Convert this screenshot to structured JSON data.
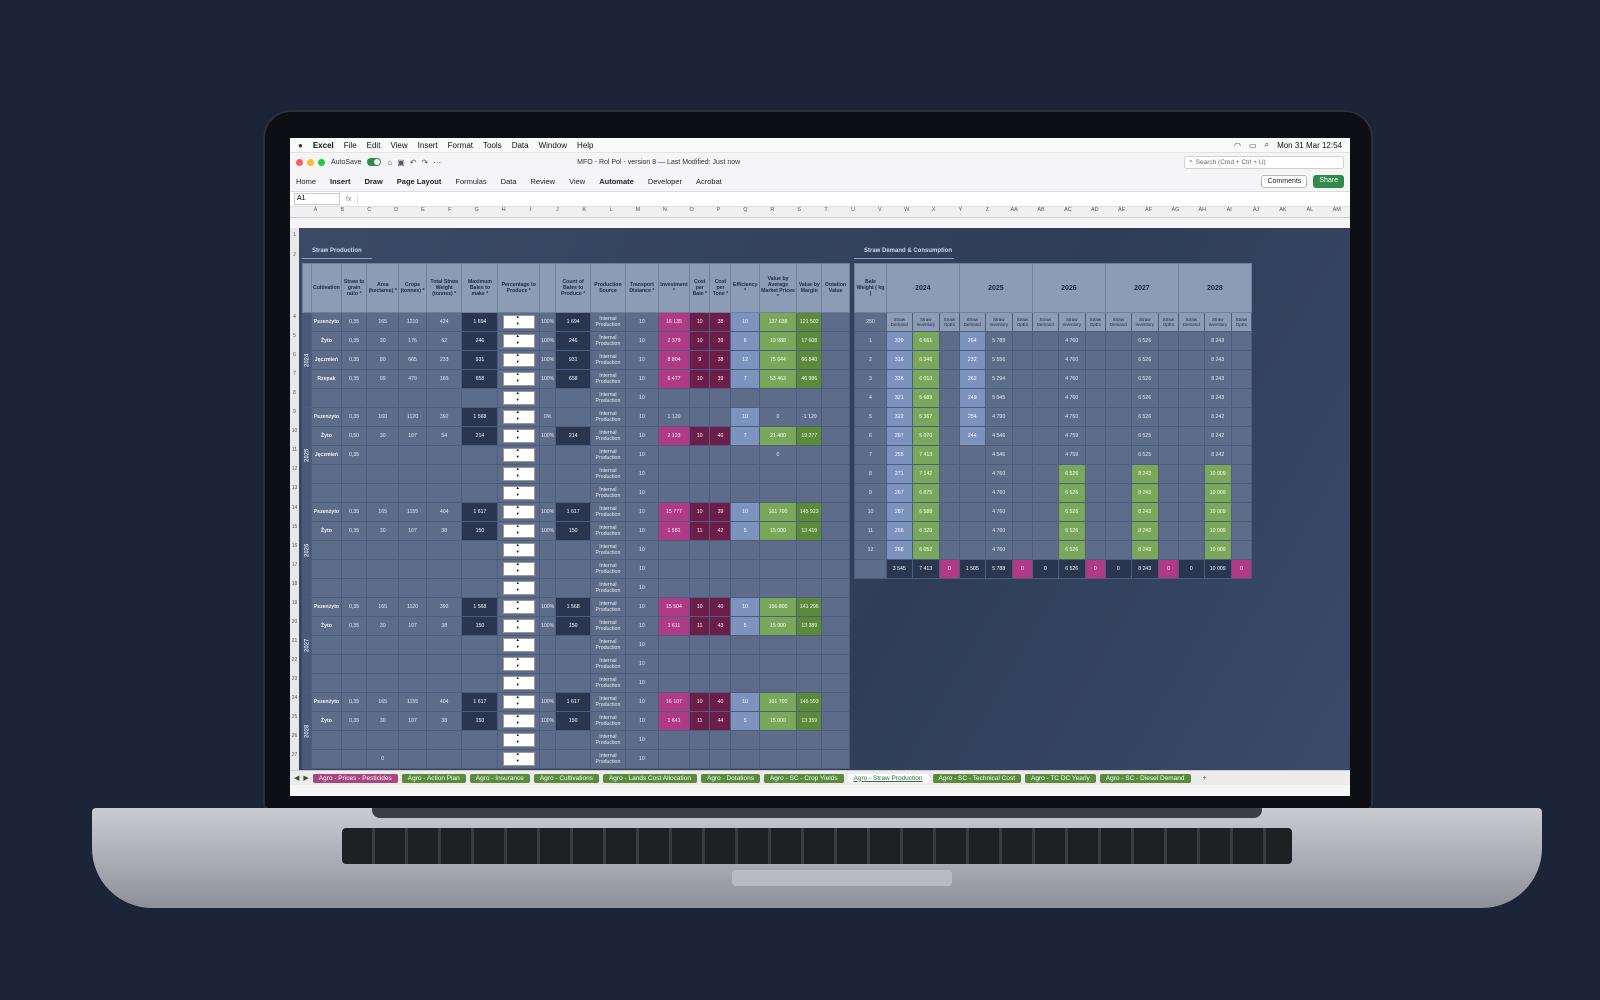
{
  "menubar": {
    "apple": "",
    "app": "Excel",
    "items": [
      "File",
      "Edit",
      "View",
      "Insert",
      "Format",
      "Tools",
      "Data",
      "Window",
      "Help"
    ],
    "clock": "Mon 31 Mar  12:54"
  },
  "titlebar": {
    "autosave": "AutoSave",
    "doc": "MFO - Rol Pol - version 8 — Last Modified: Just now",
    "search": "Search (Cmd + Ctrl + U)"
  },
  "ribbon": {
    "tabs": [
      "Home",
      "Insert",
      "Draw",
      "Page Layout",
      "Formulas",
      "Data",
      "Review",
      "View",
      "Automate",
      "Developer",
      "Acrobat"
    ],
    "comments": "Comments",
    "share": "Share"
  },
  "formula": {
    "cell": "A1",
    "fx": "fx"
  },
  "columns": [
    "A",
    "B",
    "C",
    "D",
    "E",
    "F",
    "G",
    "H",
    "I",
    "J",
    "K",
    "L",
    "M",
    "N",
    "O",
    "P",
    "Q",
    "R",
    "S",
    "T",
    "U",
    "V",
    "W",
    "X",
    "Y",
    "Z",
    "AA",
    "AB",
    "AC",
    "AD",
    "AE",
    "AF",
    "AG",
    "AH",
    "AI",
    "AJ",
    "AK",
    "AL",
    "AM"
  ],
  "rows": [
    "1",
    "2",
    "4",
    "5",
    "6",
    "7",
    "8",
    "9",
    "10",
    "11",
    "12",
    "13",
    "14",
    "15",
    "16",
    "17",
    "18",
    "19",
    "20",
    "21",
    "22",
    "23",
    "24",
    "25",
    "26",
    "27",
    "28"
  ],
  "left": {
    "title": "Straw Production",
    "headers": [
      "Cultivation",
      "Straw to grain ratio *",
      "Area (hectares) *",
      "Crops (tonnes) *",
      "Total Straw Weight (tonnes) *",
      "Maximum Bales to make *",
      "Percentage to Produce *",
      "",
      "Count of Bales to Produce *",
      "Production Source",
      "Transport Distance *",
      "Investment *",
      "Cost per Bale *",
      "Cost per Tone *",
      "Efficiency *",
      "Value by Average Market Prices *",
      "Value by Margin",
      "Dotation Value"
    ],
    "years": [
      "2024",
      "2025",
      "2026",
      "2027",
      "2028"
    ],
    "rows": [
      [
        "Pszenżyto",
        "0,35",
        "165",
        "1210",
        "424",
        "1 694",
        "",
        "100%",
        "1 694",
        "Internal Production",
        "10",
        "16 135",
        "10",
        "38",
        "10",
        "137 638",
        "121 502",
        ""
      ],
      [
        "Żyto",
        "0,35",
        "30",
        "176",
        "62",
        "246",
        "",
        "100%",
        "246",
        "Internal Production",
        "10",
        "2 379",
        "10",
        "39",
        "6",
        "19 988",
        "17 608",
        ""
      ],
      [
        "Jęczmień",
        "0,35",
        "80",
        "665",
        "233",
        "931",
        "",
        "100%",
        "931",
        "Internal Production",
        "10",
        "8 804",
        "9",
        "38",
        "12",
        "75 644",
        "66 840",
        ""
      ],
      [
        "Rzepak",
        "0,35",
        "99",
        "470",
        "165",
        "658",
        "",
        "100%",
        "658",
        "Internal Production",
        "10",
        "6 477",
        "10",
        "39",
        "7",
        "53 463",
        "46 986",
        ""
      ],
      [
        "",
        "",
        "",
        "",
        "",
        "",
        "",
        "",
        "",
        "Internal Production",
        "10",
        "",
        "",
        "",
        "",
        "",
        "",
        ""
      ],
      [
        "Pszenżyto",
        "0,35",
        "160",
        "1120",
        "392",
        "1 568",
        "",
        "0%",
        "",
        "Internal Production",
        "10",
        "1 120",
        "",
        "",
        "10",
        "0",
        "-1 120",
        ""
      ],
      [
        "Żyto",
        "0,50",
        "30",
        "107",
        "54",
        "214",
        "",
        "100%",
        "214",
        "Internal Production",
        "10",
        "2 123",
        "10",
        "40",
        "7",
        "21 400",
        "19 277",
        ""
      ],
      [
        "Jęczmień",
        "0,35",
        "",
        "",
        "",
        "",
        "",
        "",
        "",
        "Internal Production",
        "10",
        "",
        "",
        "",
        "",
        "0",
        "",
        ""
      ],
      [
        "",
        "",
        "",
        "",
        "",
        "",
        "",
        "",
        "",
        "Internal Production",
        "10",
        "",
        "",
        "",
        "",
        "",
        "",
        ""
      ],
      [
        "",
        "",
        "",
        "",
        "",
        "",
        "",
        "",
        "",
        "Internal Production",
        "10",
        "",
        "",
        "",
        "",
        "",
        "",
        ""
      ],
      [
        "Pszenżyto",
        "0,35",
        "165",
        "1155",
        "404",
        "1 617",
        "",
        "100%",
        "1 617",
        "Internal Production",
        "10",
        "15 777",
        "10",
        "39",
        "10",
        "161 700",
        "145 923",
        ""
      ],
      [
        "Żyto",
        "0,35",
        "30",
        "107",
        "38",
        "150",
        "",
        "100%",
        "150",
        "Internal Production",
        "10",
        "1 581",
        "11",
        "42",
        "5",
        "15 000",
        "13 419",
        ""
      ],
      [
        "",
        "",
        "",
        "",
        "",
        "",
        "",
        "",
        "",
        "Internal Production",
        "10",
        "",
        "",
        "",
        "",
        "",
        "",
        ""
      ],
      [
        "",
        "",
        "",
        "",
        "",
        "",
        "",
        "",
        "",
        "Internal Production",
        "10",
        "",
        "",
        "",
        "",
        "",
        "",
        ""
      ],
      [
        "",
        "",
        "",
        "",
        "",
        "",
        "",
        "",
        "",
        "Internal Production",
        "10",
        "",
        "",
        "",
        "",
        "",
        "",
        ""
      ],
      [
        "Pszenżyto",
        "0,35",
        "165",
        "1120",
        "392",
        "1 568",
        "",
        "100%",
        "1 568",
        "Internal Production",
        "10",
        "15 504",
        "10",
        "40",
        "10",
        "156 800",
        "141 296",
        ""
      ],
      [
        "Żyto",
        "0,35",
        "30",
        "107",
        "38",
        "150",
        "",
        "100%",
        "150",
        "Internal Production",
        "10",
        "1 611",
        "11",
        "43",
        "5",
        "15 000",
        "13 389",
        ""
      ],
      [
        "",
        "",
        "",
        "",
        "",
        "",
        "",
        "",
        "",
        "Internal Production",
        "10",
        "",
        "",
        "",
        "",
        "",
        "",
        ""
      ],
      [
        "",
        "",
        "",
        "",
        "",
        "",
        "",
        "",
        "",
        "Internal Production",
        "10",
        "",
        "",
        "",
        "",
        "",
        "",
        ""
      ],
      [
        "",
        "",
        "",
        "",
        "",
        "",
        "",
        "",
        "",
        "Internal Production",
        "10",
        "",
        "",
        "",
        "",
        "",
        "",
        ""
      ],
      [
        "Pszenżyto",
        "0,35",
        "165",
        "1155",
        "404",
        "1 617",
        "",
        "100%",
        "1 617",
        "Internal Production",
        "10",
        "16 107",
        "10",
        "40",
        "10",
        "161 700",
        "145 593",
        ""
      ],
      [
        "Żyto",
        "0,35",
        "30",
        "107",
        "38",
        "150",
        "",
        "100%",
        "150",
        "Internal Production",
        "10",
        "1 641",
        "11",
        "44",
        "5",
        "15 000",
        "13 359",
        ""
      ],
      [
        "",
        "",
        "",
        "",
        "",
        "",
        "",
        "",
        "",
        "Internal Production",
        "10",
        "",
        "",
        "",
        "",
        "",
        "",
        ""
      ],
      [
        "",
        "",
        "0",
        "",
        "",
        "",
        "",
        "",
        "",
        "Internal Production",
        "10",
        "",
        "",
        "",
        "",
        "",
        "",
        ""
      ]
    ]
  },
  "right": {
    "title": "Straw Demand & Consumption",
    "bale_weight_label": "Bale Weight ( kg )",
    "bale_weight": "250",
    "years": [
      "2024",
      "2025",
      "2026",
      "2027",
      "2028"
    ],
    "subheaders": [
      "Straw Demand",
      "Straw Inventory",
      "Straw OpEx"
    ],
    "rows": [
      [
        "1",
        "339",
        "6 661",
        "",
        "264",
        "5 788",
        "",
        "",
        "4 760",
        "",
        "",
        "6 526",
        "",
        "",
        "8 243",
        ""
      ],
      [
        "2",
        "316",
        "6 346",
        "",
        "232",
        "5 556",
        "",
        "",
        "4 760",
        "",
        "",
        "6 526",
        "",
        "",
        "8 243",
        ""
      ],
      [
        "3",
        "336",
        "6 010",
        "",
        "262",
        "5 294",
        "",
        "",
        "4 760",
        "",
        "",
        "6 526",
        "",
        "",
        "8 243",
        ""
      ],
      [
        "4",
        "321",
        "5 689",
        "",
        "249",
        "5 045",
        "",
        "",
        "4 760",
        "",
        "",
        "6 526",
        "",
        "",
        "8 243",
        ""
      ],
      [
        "5",
        "322",
        "5 367",
        "",
        "254",
        "4 790",
        "",
        "",
        "4 760",
        "",
        "",
        "6 526",
        "",
        "",
        "8 242",
        ""
      ],
      [
        "6",
        "297",
        "5 070",
        "",
        "244",
        "4 546",
        "",
        "",
        "4 759",
        "",
        "",
        "6 525",
        "",
        "",
        "8 242",
        ""
      ],
      [
        "7",
        "255",
        "7 413",
        "",
        "",
        "4 546",
        "",
        "",
        "4 759",
        "",
        "",
        "6 525",
        "",
        "",
        "8 242",
        ""
      ],
      [
        "8",
        "271",
        "7 142",
        "",
        "",
        "4 760",
        "",
        "",
        "6 526",
        "",
        "",
        "8 243",
        "",
        "",
        "10 009",
        ""
      ],
      [
        "9",
        "267",
        "6 875",
        "",
        "",
        "4 760",
        "",
        "",
        "6 526",
        "",
        "",
        "8 243",
        "",
        "",
        "10 009",
        ""
      ],
      [
        "10",
        "287",
        "6 588",
        "",
        "",
        "4 760",
        "",
        "",
        "6 526",
        "",
        "",
        "8 243",
        "",
        "",
        "10 009",
        ""
      ],
      [
        "11",
        "266",
        "6 320",
        "",
        "",
        "4 760",
        "",
        "",
        "6 526",
        "",
        "",
        "8 243",
        "",
        "",
        "10 009",
        ""
      ],
      [
        "12",
        "268",
        "6 052",
        "",
        "",
        "4 760",
        "",
        "",
        "6 526",
        "",
        "",
        "8 243",
        "",
        "",
        "10 009",
        ""
      ]
    ],
    "totals": [
      "",
      "3 545",
      "7 413",
      "0",
      "1 505",
      "5 788",
      "0",
      "0",
      "6 526",
      "0",
      "0",
      "8 243",
      "0",
      "0",
      "10 009",
      "0"
    ]
  },
  "sheet_tabs": [
    "Agro - Prices - Pesticides",
    "Agro - Action Plan",
    "Agro - Insurance",
    "Agro - Cultivations",
    "Agro - Lands Cost Allocation",
    "Agro - Dotations",
    "Agro - SC - Crop Yields",
    "Agro - Straw Production",
    "Agro - SC - Technical Cost",
    "Agro - TC DC Yearly",
    "Agro - SC - Diesel Demand"
  ],
  "active_tab": "Agro - Straw Production"
}
